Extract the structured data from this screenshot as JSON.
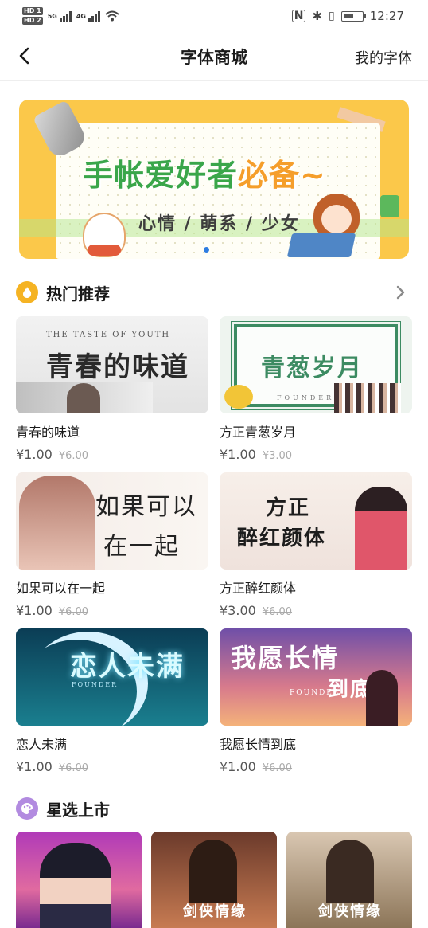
{
  "status_bar": {
    "hd1": "HD 1",
    "hd2": "HD 2",
    "net1": "5G",
    "net2": "4G",
    "time": "12:27"
  },
  "nav": {
    "title": "字体商城",
    "right": "我的字体"
  },
  "banner": {
    "headline": "手帐爱好者",
    "headline_tail": "必备~",
    "subtitle": "心情 / 萌系 / 少女"
  },
  "hot": {
    "title": "热门推荐",
    "items": [
      {
        "name": "青春的味道",
        "price": "¥1.00",
        "old_price": "¥6.00",
        "art": "青春的味道",
        "art_caption": "THE TASTE OF YOUTH"
      },
      {
        "name": "方正青葱岁月",
        "price": "¥1.00",
        "old_price": "¥3.00",
        "art": "青葱岁月",
        "art_caption": "FOUNDER"
      },
      {
        "name": "如果可以在一起",
        "price": "¥1.00",
        "old_price": "¥6.00",
        "art": "如果可以",
        "art2": "在一起"
      },
      {
        "name": "方正醉红颜体",
        "price": "¥3.00",
        "old_price": "¥6.00",
        "art": "方正",
        "art2": "醉红颜体"
      },
      {
        "name": "恋人未满",
        "price": "¥1.00",
        "old_price": "¥6.00",
        "art": "恋人未满",
        "art_caption": "FOUNDER"
      },
      {
        "name": "我愿长情到底",
        "price": "¥1.00",
        "old_price": "¥6.00",
        "art": "我愿长情",
        "art2": "到底",
        "art_caption": "FOUNDER"
      }
    ]
  },
  "star": {
    "title": "星选上市",
    "cards": [
      {
        "art": ""
      },
      {
        "art": "剑侠情缘"
      },
      {
        "art": "剑侠情缘"
      }
    ]
  },
  "colors": {
    "hot_icon": "#f5b323",
    "star_icon": "#b28be0",
    "banner_bg": "#fbc84a",
    "accent_blue": "#2e7de1"
  }
}
